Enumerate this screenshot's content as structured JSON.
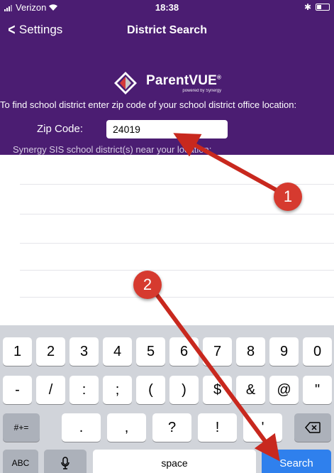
{
  "status": {
    "carrier": "Verizon",
    "time": "18:38"
  },
  "nav": {
    "back_label": "Settings",
    "title": "District Search"
  },
  "logo": {
    "name": "ParentVUE",
    "registered": "®",
    "sub": "powered by Synergy"
  },
  "form": {
    "instructions": "To find school district enter zip code of your school district office location:",
    "zip_label": "Zip Code:",
    "zip_value": "24019",
    "near_label": "Synergy SIS school district(s) near your location:"
  },
  "keyboard": {
    "row1": [
      "1",
      "2",
      "3",
      "4",
      "5",
      "6",
      "7",
      "8",
      "9",
      "0"
    ],
    "row2": [
      "-",
      "/",
      ":",
      ";",
      "(",
      ")",
      "$",
      "&",
      "@",
      "\""
    ],
    "row3_left": "#+=",
    "row3": [
      ".",
      ",",
      "?",
      "!",
      "'"
    ],
    "row3_right_icon": "backspace-icon",
    "abc_label": "ABC",
    "mic_icon": "microphone-icon",
    "space_label": "space",
    "search_label": "Search"
  },
  "annotations": {
    "step1": "1",
    "step2": "2",
    "arrow_color": "#d63a2f"
  },
  "colors": {
    "header_bg": "#4b1d72",
    "search_key": "#2f80ed"
  }
}
